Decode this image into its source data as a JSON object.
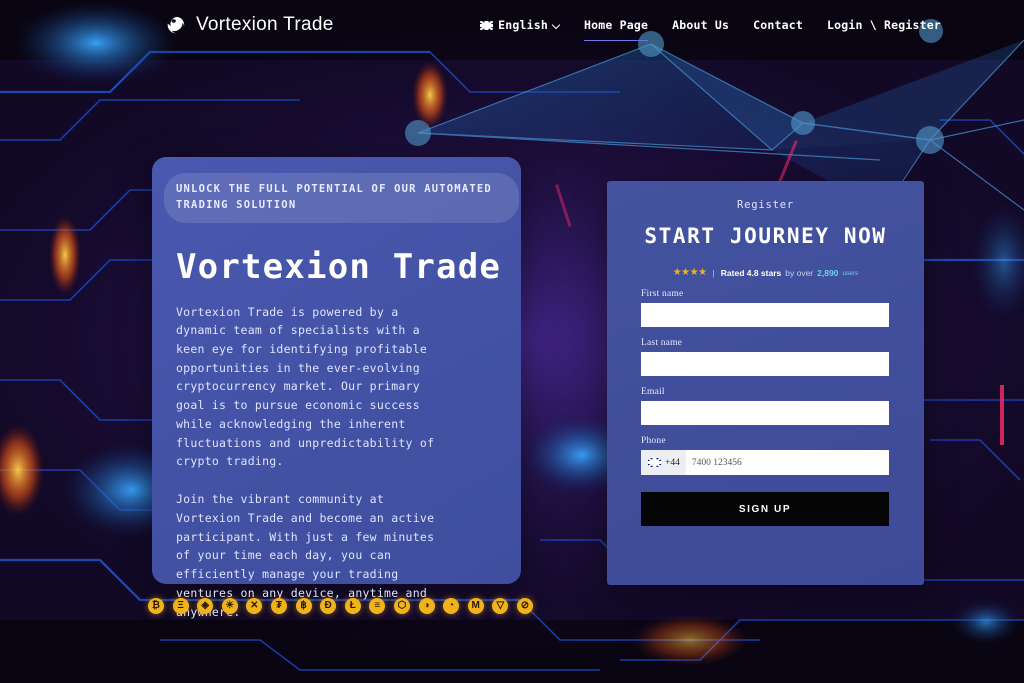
{
  "header": {
    "logo_icon": "globe-swirl-icon",
    "brand": "Vortexion Trade",
    "language": {
      "flag_icon": "uk-flag-icon",
      "label": "English",
      "chevron_icon": "chevron-down-icon"
    },
    "nav": [
      {
        "label": "Home Page",
        "active": true
      },
      {
        "label": "About Us",
        "active": false
      },
      {
        "label": "Contact",
        "active": false
      },
      {
        "label": "Login \\ Register",
        "active": false
      }
    ]
  },
  "hero": {
    "eyebrow": "UNLOCK THE FULL POTENTIAL OF OUR AUTOMATED TRADING SOLUTION",
    "title": "Vortexion Trade",
    "paragraph_1": "Vortexion Trade is powered by a dynamic team of specialists with a keen eye for identifying profitable opportunities in the ever-evolving cryptocurrency market. Our primary goal is to pursue economic success while acknowledging the inherent fluctuations and unpredictability of crypto trading.",
    "paragraph_2": "Join the vibrant community at Vortexion Trade and become an active participant. With just a few minutes of your time each day, you can efficiently manage your trading ventures on any device, anytime and anywhere."
  },
  "register": {
    "eyebrow": "Register",
    "title": "START JOURNEY NOW",
    "rating": {
      "stars_filled": 4,
      "stars_glyph": "★★★★",
      "divider": "|",
      "text_strong": "Rated 4.8 stars",
      "text_dim": " by over ",
      "count": "2,890",
      "unit": "users"
    },
    "fields": [
      {
        "label": "First name",
        "value": "",
        "placeholder": "",
        "name": "first-name"
      },
      {
        "label": "Last name",
        "value": "",
        "placeholder": "",
        "name": "last-name"
      },
      {
        "label": "Email",
        "value": "",
        "placeholder": "",
        "name": "email"
      }
    ],
    "phone": {
      "label": "Phone",
      "flag_icon": "uk-flag-icon",
      "dial_code": "+44",
      "placeholder": "7400 123456",
      "value": ""
    },
    "submit_label": "SIGN UP"
  },
  "coins": [
    {
      "name": "bitcoin-icon",
      "symbol": "₿"
    },
    {
      "name": "ethereum-icon",
      "symbol": "Ξ"
    },
    {
      "name": "diamond-icon",
      "symbol": "◈"
    },
    {
      "name": "sun-gear-icon",
      "symbol": "☀"
    },
    {
      "name": "xrp-icon",
      "symbol": "✕"
    },
    {
      "name": "tether-icon",
      "symbol": "₮"
    },
    {
      "name": "spiral-icon",
      "symbol": "฿"
    },
    {
      "name": "dogecoin-icon",
      "symbol": "Đ"
    },
    {
      "name": "litecoin-icon",
      "symbol": "Ł"
    },
    {
      "name": "eos-icon",
      "symbol": "≡"
    },
    {
      "name": "chainlink-icon",
      "symbol": "⬡"
    },
    {
      "name": "rabbit-icon",
      "symbol": "◑"
    },
    {
      "name": "cat-icon",
      "symbol": "◔"
    },
    {
      "name": "monero-icon",
      "symbol": "M"
    },
    {
      "name": "tron-icon",
      "symbol": "▽"
    },
    {
      "name": "arbitrum-icon",
      "symbol": "⊘"
    }
  ],
  "colors": {
    "card_blue": "#4352a4",
    "panel_blue": "#3f4d9b",
    "accent_gold": "#f0b31c",
    "accent_cyan": "#6fd0e8",
    "nav_underline": "#6f74e8",
    "button_black": "#050505",
    "background_dark": "#0a0512"
  }
}
